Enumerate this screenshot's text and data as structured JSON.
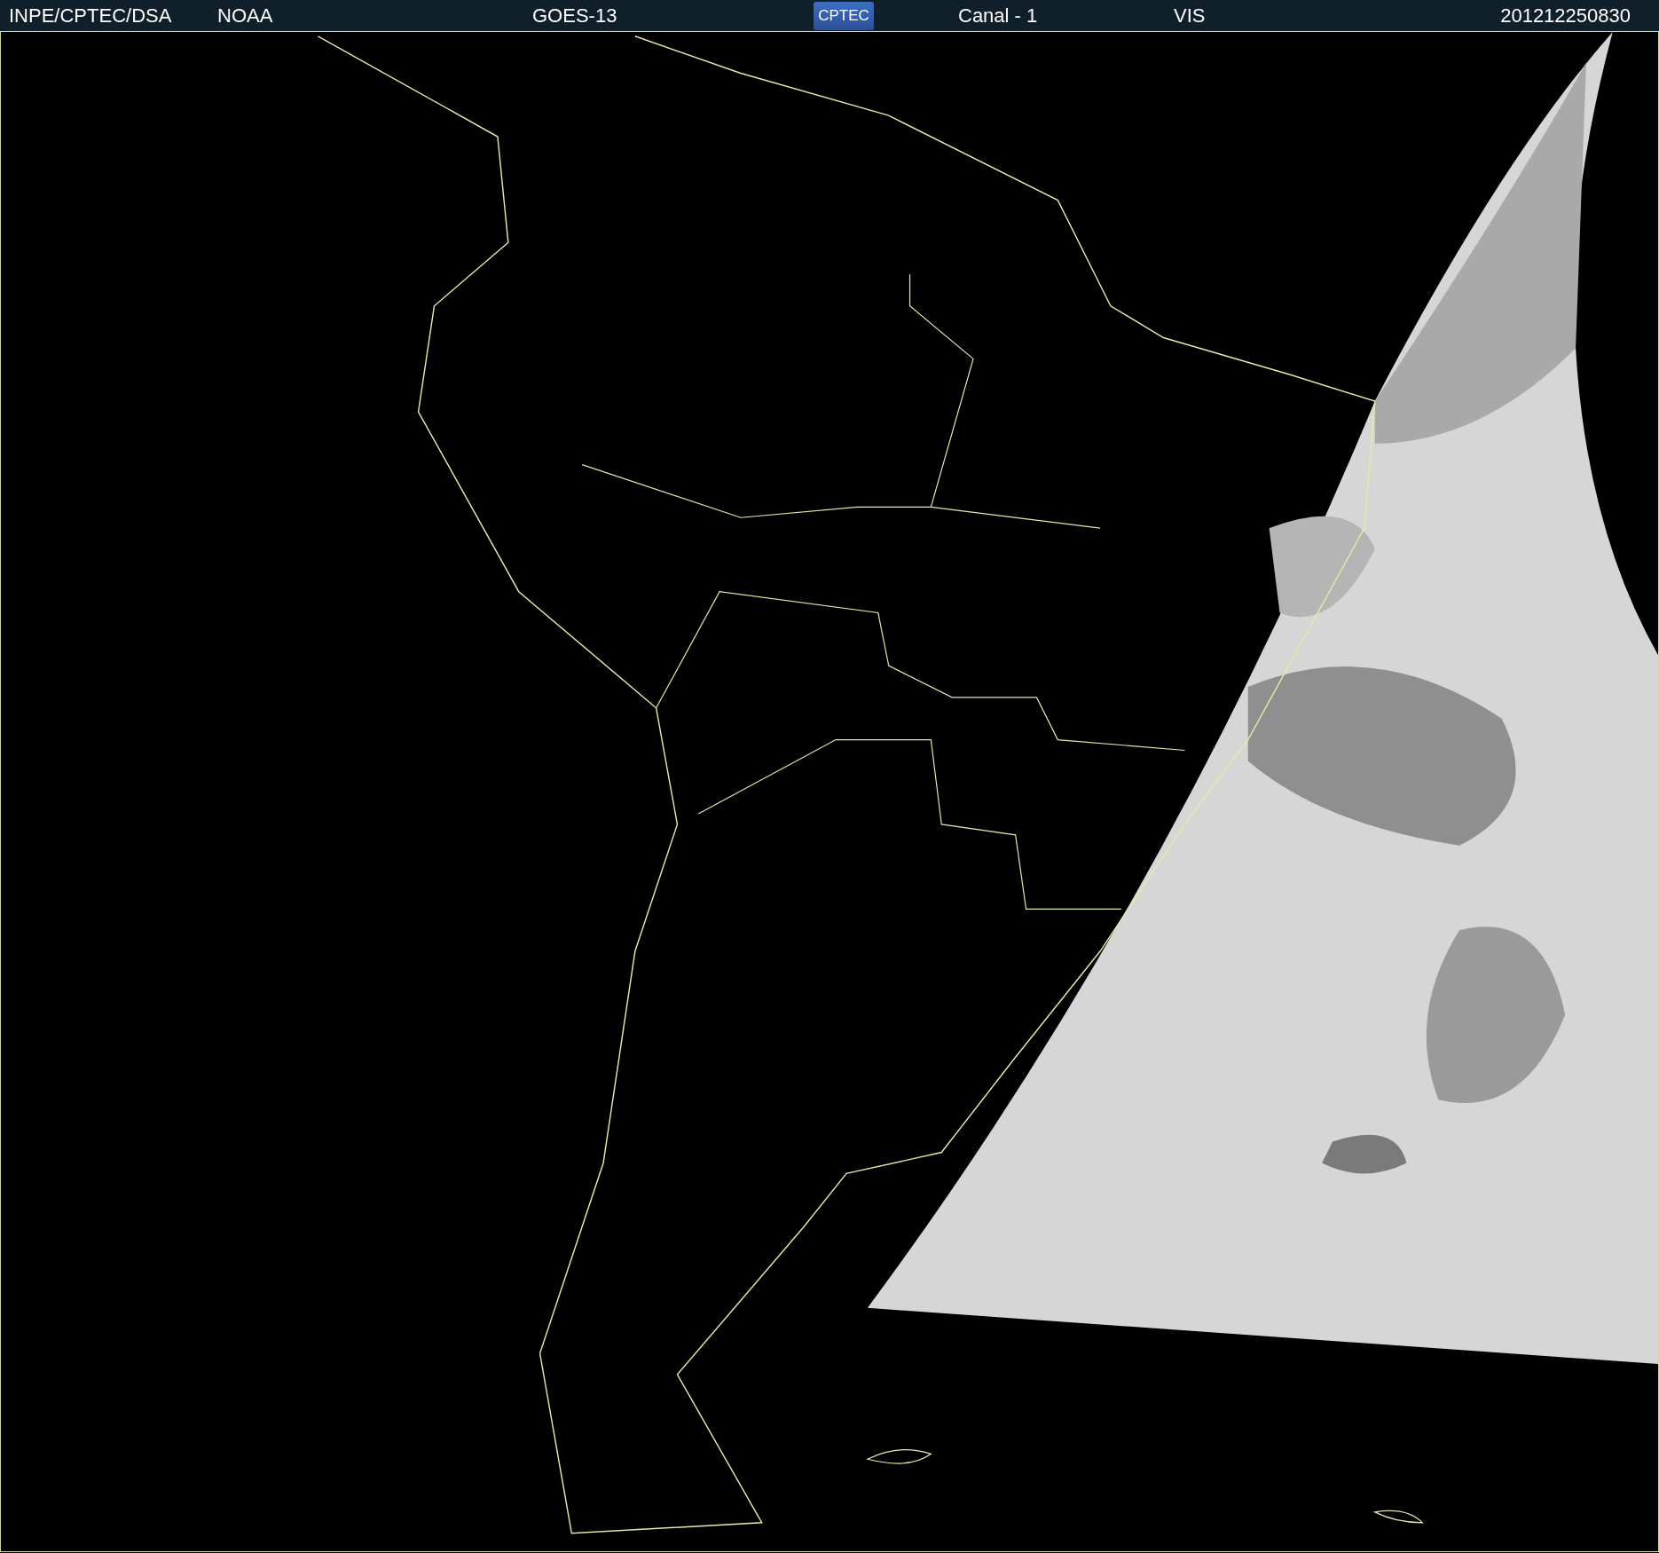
{
  "header": {
    "items": [
      {
        "kind": "text",
        "text": "INPE/CPTEC/DSA"
      },
      {
        "kind": "text",
        "text": "NOAA"
      },
      {
        "kind": "text",
        "text": "GOES-13"
      },
      {
        "kind": "logo",
        "text": "CPTEC"
      },
      {
        "kind": "text",
        "text": "Canal - 1"
      },
      {
        "kind": "text",
        "text": "VIS"
      },
      {
        "kind": "text",
        "text": "201212250830"
      }
    ]
  }
}
